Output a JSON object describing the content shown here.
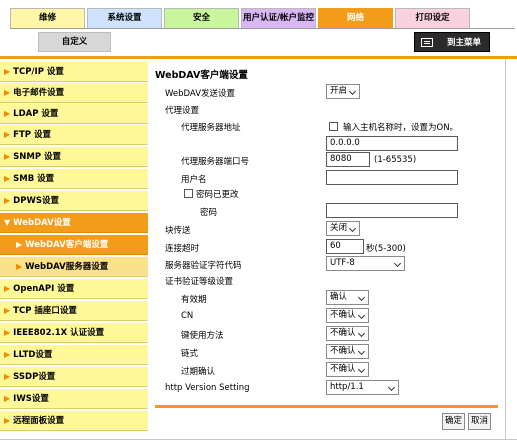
{
  "tabs": {
    "maintenance": "维修",
    "system": "系统设置",
    "security": "安全",
    "user_auth": "用户认证/帐户监控",
    "network": "网络",
    "print": "打印设定"
  },
  "subtab_custom": "自定义",
  "main_menu": "到主菜单",
  "sidebar": {
    "tcpip": "TCP/IP 设置",
    "email": "电子邮件设置",
    "ldap": "LDAP 设置",
    "ftp": "FTP 设置",
    "snmp": "SNMP 设置",
    "smb": "SMB 设置",
    "dpws": "DPWS设置",
    "webdav": "WebDAV设置",
    "webdav_client": "WebDAV客户端设置",
    "webdav_server": "WebDAV服务器设置",
    "openapi": "OpenAPI 设置",
    "tcp_socket": "TCP 插座口设置",
    "ieee8021x": "IEEE802.1X 认证设置",
    "lltd": "LLTD设置",
    "ssdp": "SSDP设置",
    "iws": "IWS设置",
    "remote_panel": "远程面板设置"
  },
  "form": {
    "title": "WebDAV客户端设置",
    "send_setting_label": "WebDAV发送设置",
    "send_setting_value": "开启",
    "proxy_label": "代理设置",
    "proxy_address_label": "代理服务器地址",
    "proxy_hostname_hint": "输入主机名称时，设置为ON。",
    "proxy_address_value": "0.0.0.0",
    "proxy_port_label": "代理服务器端口号",
    "proxy_port_value": "8080",
    "proxy_port_range": "(1-65535)",
    "username_label": "用户名",
    "username_value": "",
    "password_changed_label": "密码已更改",
    "password_label": "密码",
    "password_value": "",
    "chunk_label": "块传送",
    "chunk_value": "关闭",
    "timeout_label": "连接超时",
    "timeout_value": "60",
    "timeout_unit": "秒(5-300)",
    "charset_label": "服务器验证字符代码",
    "charset_value": "UTF-8",
    "cert_label": "证书验证等级设置",
    "validity_label": "有效期",
    "validity_value": "确认",
    "cn_label": "CN",
    "cn_value": "不确认",
    "key_usage_label": "键使用方法",
    "key_usage_value": "不确认",
    "chain_label": "链式",
    "chain_value": "不确认",
    "expiry_label": "过期确认",
    "expiry_value": "不确认",
    "http_version_label": "http Version Setting",
    "http_version_value": "http/1.1"
  },
  "buttons": {
    "ok": "确定",
    "cancel": "取消"
  },
  "colors": {
    "accent_orange": "#f39c1a",
    "sidebar_yellow": "#fff899",
    "tab_maintenance": "#fff6a8",
    "tab_system": "#cfe3ff",
    "tab_security": "#c9f59d",
    "tab_user_auth": "#d9b7f5",
    "tab_print": "#fbd0df"
  }
}
